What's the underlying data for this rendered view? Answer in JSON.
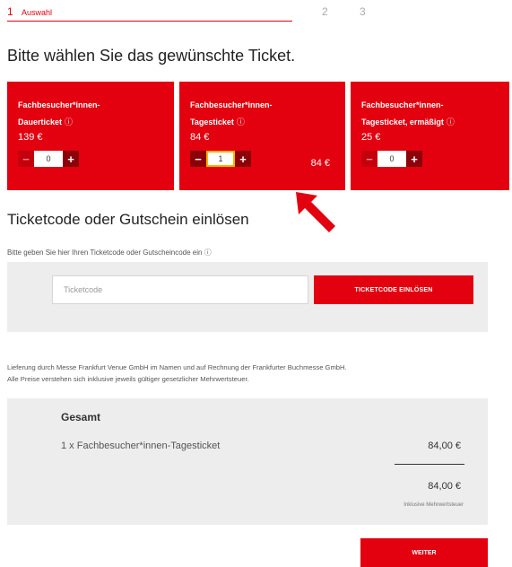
{
  "steps": {
    "step1_number": "1",
    "step1_label": "Auswahl",
    "step2_number": "2",
    "step3_number": "3"
  },
  "title": "Bitte wählen Sie das gewünschte Ticket.",
  "tickets": [
    {
      "name_line1": "Fachbesucher*innen-",
      "name_line2": "Dauerticket",
      "info_icon": "ⓘ",
      "price": "139 €",
      "quantity": "0",
      "minus": "−",
      "plus": "+",
      "subtotal": ""
    },
    {
      "name_line1": "Fachbesucher*innen-",
      "name_line2": "Tagesticket",
      "info_icon": "ⓘ",
      "price": "84 €",
      "quantity": "1",
      "minus": "−",
      "plus": "+",
      "subtotal": "84 €"
    },
    {
      "name_line1": "Fachbesucher*innen-",
      "name_line2": "Tagesticket, ermäßigt",
      "info_icon": "ⓘ",
      "price": "25 €",
      "quantity": "0",
      "minus": "−",
      "plus": "+",
      "subtotal": ""
    }
  ],
  "code_section": {
    "title": "Ticketcode oder Gutschein einlösen",
    "hint": "Bitte geben Sie hier Ihren Ticketcode oder Gutscheincode ein ⓘ",
    "input_placeholder": "Ticketcode",
    "input_value": "",
    "button_label": "TICKETCODE EINLÖSEN"
  },
  "legal": {
    "line1": "Lieferung durch Messe Frankfurt Venue GmbH im Namen und auf Rechnung der Frankfurter Buchmesse GmbH.",
    "line2": "Alle Preise verstehen sich inklusive jeweils gültiger gesetzlicher Mehrwertsteuer."
  },
  "summary": {
    "title": "Gesamt",
    "item": "1 x Fachbesucher*innen-Tagesticket",
    "item_price": "84,00 €",
    "total": "84,00 €",
    "vat_note": "Inklusive Mehrwertsteuer"
  },
  "weiter_label": "WEITER",
  "colors": {
    "accent": "#e3000f",
    "dark_accent": "#8b0009",
    "panel": "#ededed"
  }
}
